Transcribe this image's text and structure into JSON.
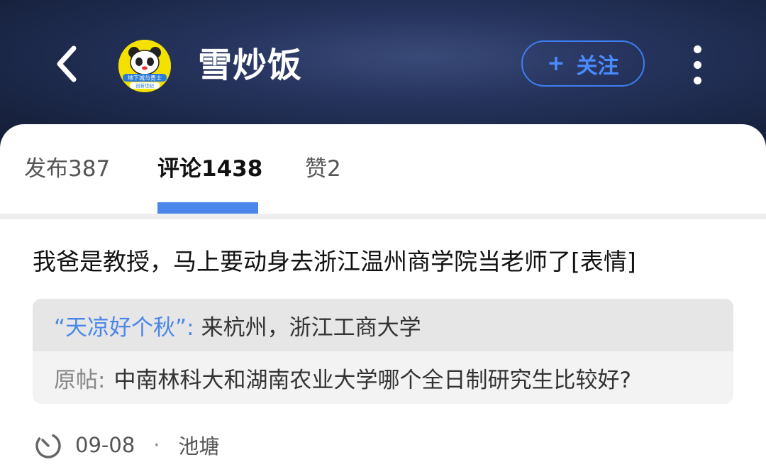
{
  "header": {
    "title": "雪炒饭",
    "follow_plus": "+",
    "follow_label": "关注",
    "avatar_text_line1": "地下城与勇士",
    "avatar_text_line2": "创新世纪"
  },
  "tabs": [
    {
      "label": "发布387",
      "active": false
    },
    {
      "label": "评论1438",
      "active": true
    },
    {
      "label": "赞2",
      "active": false
    }
  ],
  "post": {
    "text": "我爸是教授，马上要动身去浙江温州商学院当老师了[表情]",
    "reply_user": "“天凉好个秋”:",
    "reply_text": "来杭州，浙江工商大学",
    "orig_label": "原帖:",
    "orig_text": "中南林科大和湖南农业大学哪个全日制研究生比较好?",
    "date": "09-08",
    "separator": "·",
    "source": "池塘"
  },
  "colors": {
    "accent": "#4b86ec",
    "header_bg": "#1d2a4a",
    "avatar_bg": "#f5e100"
  },
  "icons": {
    "back": "chevron-left-icon",
    "more": "more-vertical-icon",
    "time": "clock-icon"
  }
}
